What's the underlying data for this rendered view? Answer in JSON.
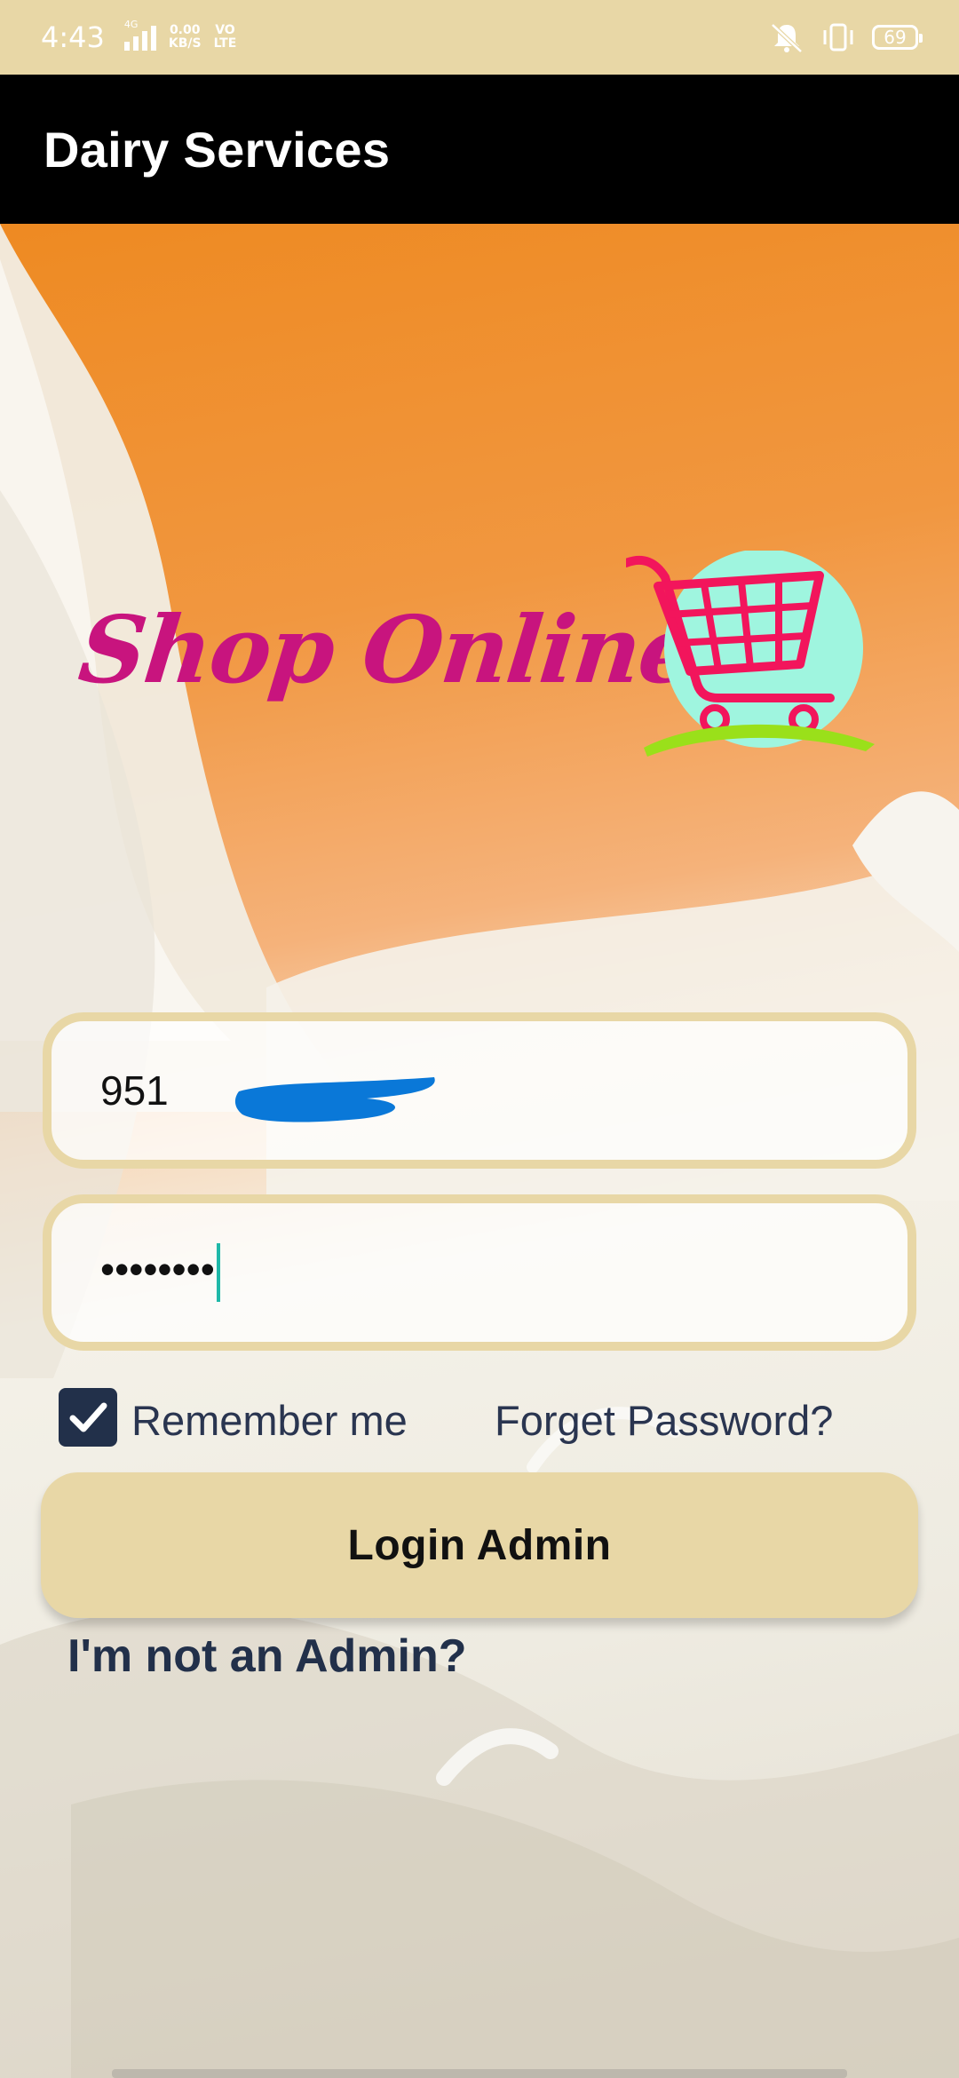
{
  "status_bar": {
    "time": "4:43",
    "network_type": "4G",
    "speed_value": "0.00",
    "speed_unit": "KB/S",
    "volte_top": "VO",
    "volte_bottom": "LTE",
    "battery": "69"
  },
  "app_bar": {
    "title": "Dairy Services"
  },
  "logo": {
    "text": "Shop Online"
  },
  "login_form": {
    "phone_value": "951",
    "password_value": "••••••••",
    "remember_label": "Remember me",
    "remember_checked": true,
    "forget_password": "Forget Password?",
    "login_button": "Login Admin",
    "not_admin_link": "I'm not an Admin?"
  },
  "colors": {
    "status_bar_bg": "#e8d7a6",
    "app_bar_bg": "#000000",
    "field_border": "#e8d7a6",
    "button_bg": "#e8d7a6",
    "logo_text": "#c8147e",
    "cart": "#f2155c",
    "checkbox": "#22304a"
  },
  "icons": [
    "signal-icon",
    "mute-icon",
    "vibrate-icon",
    "battery-icon",
    "shopping-cart-icon",
    "check-icon"
  ]
}
